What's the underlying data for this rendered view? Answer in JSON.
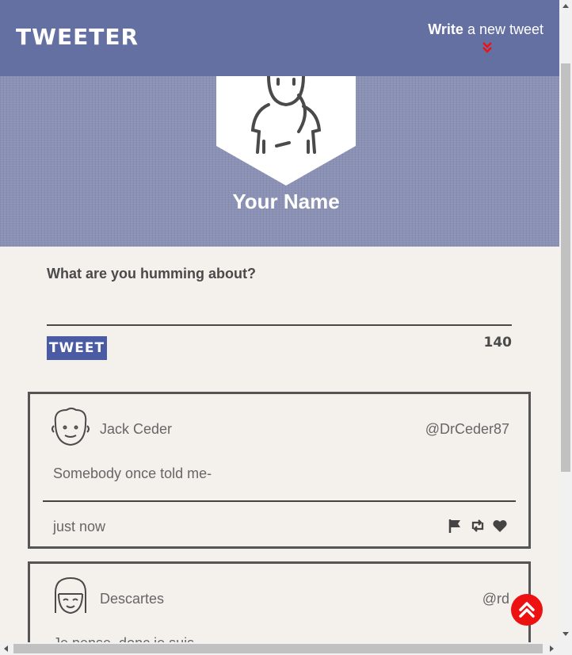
{
  "nav": {
    "brand": "TWEETER",
    "compose_bold": "Write",
    "compose_rest": " a new tweet"
  },
  "profile": {
    "name": "Your Name"
  },
  "composer": {
    "label": "What are you humming about?",
    "placeholder": "",
    "button_label": "TWEET",
    "counter": "140"
  },
  "tweets": [
    {
      "name": "Jack Ceder",
      "handle": "@DrCeder87",
      "body": "Somebody once told me-",
      "time": "just now"
    },
    {
      "name": "Descartes",
      "handle": "@rd",
      "body": "Je pense, donc je suis"
    }
  ],
  "colors": {
    "nav": "#6570a2",
    "hero": "#8a91b4",
    "accent": "#4a5aa3",
    "scroll_top": "#ee1111",
    "background": "#f4f1ec"
  }
}
